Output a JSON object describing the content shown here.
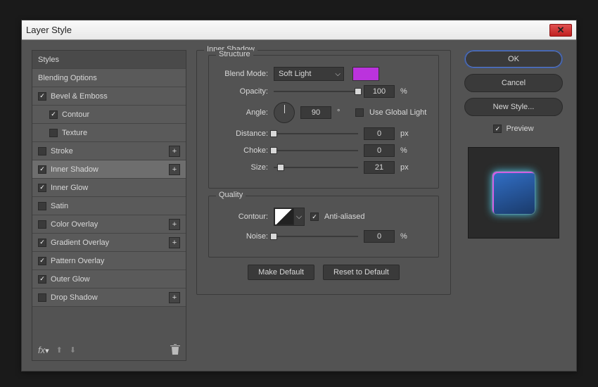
{
  "window": {
    "title": "Layer Style"
  },
  "styles": {
    "header": "Styles",
    "blending": "Blending Options",
    "items": [
      {
        "label": "Bevel & Emboss",
        "checked": true,
        "plus": false
      },
      {
        "label": "Contour",
        "checked": true,
        "plus": false,
        "indent": true
      },
      {
        "label": "Texture",
        "checked": false,
        "plus": false,
        "indent": true
      },
      {
        "label": "Stroke",
        "checked": false,
        "plus": true
      },
      {
        "label": "Inner Shadow",
        "checked": true,
        "plus": true,
        "selected": true
      },
      {
        "label": "Inner Glow",
        "checked": true,
        "plus": false
      },
      {
        "label": "Satin",
        "checked": false,
        "plus": false
      },
      {
        "label": "Color Overlay",
        "checked": false,
        "plus": true
      },
      {
        "label": "Gradient Overlay",
        "checked": true,
        "plus": true
      },
      {
        "label": "Pattern Overlay",
        "checked": true,
        "plus": false
      },
      {
        "label": "Outer Glow",
        "checked": true,
        "plus": false
      },
      {
        "label": "Drop Shadow",
        "checked": false,
        "plus": true
      }
    ]
  },
  "main": {
    "section": "Inner Shadow",
    "structure": {
      "title": "Structure",
      "blend_mode_label": "Blend Mode:",
      "blend_mode_value": "Soft Light",
      "color": "#bb33dd",
      "opacity_label": "Opacity:",
      "opacity_value": "100",
      "opacity_unit": "%",
      "angle_label": "Angle:",
      "angle_value": "90",
      "angle_unit": "°",
      "global_light_label": "Use Global Light",
      "global_light_checked": false,
      "distance_label": "Distance:",
      "distance_value": "0",
      "distance_unit": "px",
      "choke_label": "Choke:",
      "choke_value": "0",
      "choke_unit": "%",
      "size_label": "Size:",
      "size_value": "21",
      "size_unit": "px"
    },
    "quality": {
      "title": "Quality",
      "contour_label": "Contour:",
      "antialiased_label": "Anti-aliased",
      "antialiased_checked": true,
      "noise_label": "Noise:",
      "noise_value": "0",
      "noise_unit": "%"
    },
    "buttons": {
      "make_default": "Make Default",
      "reset_default": "Reset to Default"
    }
  },
  "right": {
    "ok": "OK",
    "cancel": "Cancel",
    "new_style": "New Style...",
    "preview_label": "Preview",
    "preview_checked": true
  }
}
